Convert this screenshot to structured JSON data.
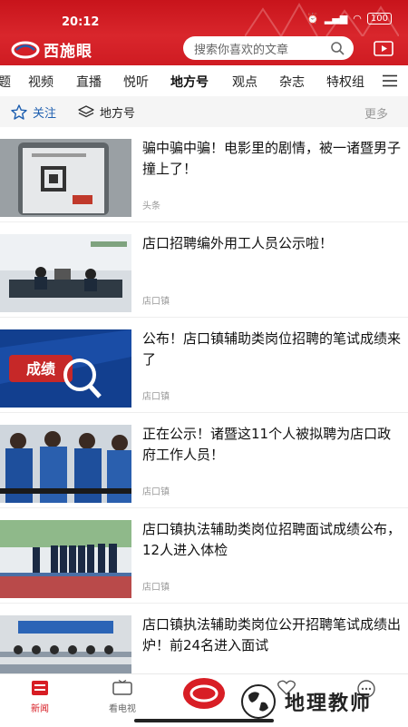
{
  "status": {
    "time": "20:12",
    "battery": "100"
  },
  "app": {
    "name": "西施眼"
  },
  "search": {
    "placeholder": "搜索你喜欢的文章"
  },
  "tabs": [
    "题",
    "视频",
    "直播",
    "悦听",
    "地方号",
    "观点",
    "杂志",
    "特权组"
  ],
  "active_tab": "地方号",
  "follow_bar": {
    "follow": "关注",
    "local": "地方号",
    "more": "更多"
  },
  "articles": [
    {
      "title": "骗中骗中骗！电影里的剧情，被一诸暨男子撞上了！",
      "source": "头条"
    },
    {
      "title": "店口招聘编外用工人员公示啦！",
      "source": "店口镇"
    },
    {
      "title": "公布！店口镇辅助类岗位招聘的笔试成绩来了",
      "source": "店口镇",
      "thumb_text": "成绩"
    },
    {
      "title": "正在公示！诸暨这11个人被拟聘为店口政府工作人员！",
      "source": "店口镇"
    },
    {
      "title": "店口镇执法辅助类岗位招聘面试成绩公布，12人进入体检",
      "source": "店口镇"
    },
    {
      "title": "店口镇执法辅助类岗位公开招聘笔试成绩出炉！前24名进入面试",
      "source": ""
    }
  ],
  "bottom_nav": [
    {
      "label": "新闻",
      "icon": "news-icon"
    },
    {
      "label": "看电视",
      "icon": "tv-icon"
    },
    {
      "label": "",
      "icon": "center-logo-icon"
    },
    {
      "label": "",
      "icon": "heart-icon"
    },
    {
      "label": "",
      "icon": "chat-icon"
    }
  ],
  "watermark": {
    "text": "地理教师"
  },
  "colors": {
    "brand_red": "#d71d24",
    "follow_blue": "#1e5fb0"
  }
}
